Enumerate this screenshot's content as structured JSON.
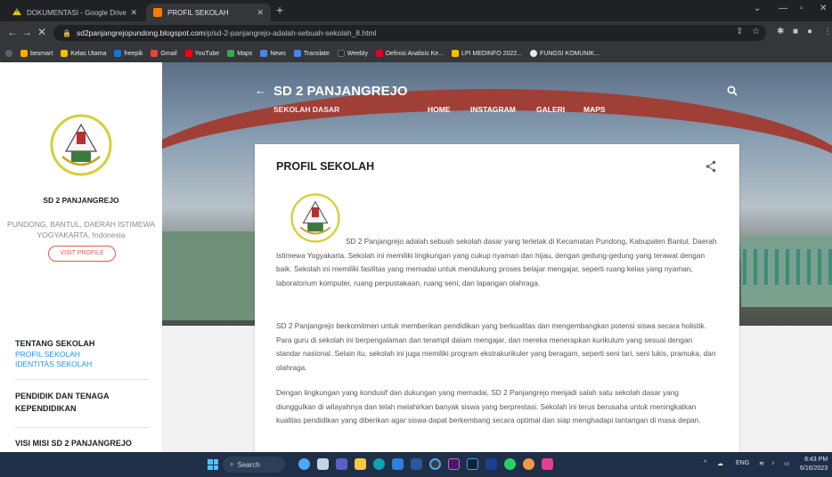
{
  "browser": {
    "tabs": [
      {
        "title": "DOKUMENTASI - Google Drive",
        "active": false
      },
      {
        "title": "PROFIL SEKOLAH",
        "active": true
      }
    ],
    "new_tab": "+",
    "address": {
      "host": "sd2panjangrejopundong.blogspot.com",
      "path": "/p/sd-2-panjangrejo-adalah-sebuah-sekolah_8.html"
    },
    "bookmarks": [
      "besmart",
      "Kelas Utama",
      "freepik",
      "Gmail",
      "YouTube",
      "Maps",
      "News",
      "Translate",
      "Weebly",
      "Definisi Analisis Ke...",
      "LPI MEDINFO 2022...",
      "FUNGSI KOMUNIK..."
    ]
  },
  "sidebar": {
    "profile_name": "SD 2 PANJANGREJO",
    "location": "PUNDONG, BANTUL, DAERAH ISTIMEWA YOGYAKARTA, Indonesia",
    "visit_label": "VISIT PROFILE",
    "sections": [
      {
        "title": "TENTANG SEKOLAH",
        "links": [
          "PROFIL SEKOLAH",
          "IDENTITAS SEKOLAH"
        ]
      },
      {
        "title": "PENDIDIK DAN TENAGA KEPENDIDIKAN",
        "links": []
      },
      {
        "title": "VISI MISI SD 2 PANJANGREJO",
        "links": []
      }
    ]
  },
  "header": {
    "blog_title": "SD 2 PANJANGREJO",
    "description": "SEKOLAH DASAR",
    "nav": [
      "HOME",
      "INSTAGRAM",
      "GALERI",
      "MAPS"
    ]
  },
  "article": {
    "title": "PROFIL SEKOLAH",
    "paragraphs": [
      "SD 2 Panjangrejo adalah sebuah sekolah dasar yang terletak di Kecamatan Pundong, Kabupaten Bantul, Daerah Istimewa Yogyakarta. Sekolah ini memiliki lingkungan yang cukup nyaman dan hijau, dengan gedung-gedung yang terawat dengan baik. Sekolah ini memiliki fasilitas yang memadai untuk mendukung proses belajar mengajar, seperti ruang kelas yang nyaman, laboratorium komputer, ruang perpustakaan, ruang seni, dan lapangan olahraga.",
      "SD 2 Panjangrejo berkomitmen untuk memberikan pendidikan yang berkualitas dan mengembangkan potensi siswa secara holistik. Para guru di sekolah ini berpengalaman dan terampil dalam mengajar, dan mereka menerapkan kurikulum yang sesuai dengan standar nasional. Selain itu, sekolah ini juga memiliki program ekstrakurikuler yang beragam, seperti seni tari, seni lukis, pramuka, dan olahraga.",
      "Dengan lingkungan yang kondusif dan dukungan yang memadai, SD 2 Panjangrejo menjadi salah satu sekolah dasar yang diunggulkan di wilayahnya dan telah melahirkan banyak siswa yang berprestasi. Sekolah ini terus berusaha untuk meningkatkan kualitas pendidikan yang diberikan agar siswa dapat berkembang secara optimal dan siap menghadapi tantangan di masa depan."
    ]
  },
  "taskbar": {
    "search_label": "Search",
    "lang": "ENG",
    "time": "8:43 PM",
    "date": "6/16/2023"
  },
  "colors": {
    "accent_link": "#2196f3",
    "visit_button": "#e05a4f",
    "roof": "#a03f36"
  }
}
